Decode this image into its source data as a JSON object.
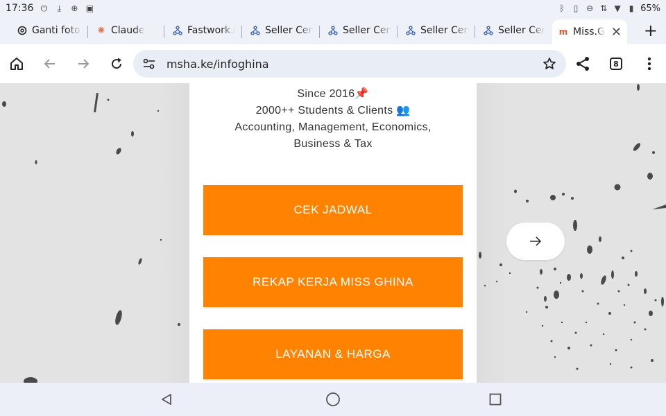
{
  "status_bar": {
    "time": "17:36",
    "battery": "65%"
  },
  "tabs": [
    {
      "title": "Ganti foto c",
      "icon": "openai-icon"
    },
    {
      "title": "Claude",
      "icon": "claude-icon"
    },
    {
      "title": "Fastwork.id",
      "icon": "fastwork-icon"
    },
    {
      "title": "Seller Cent",
      "icon": "seller-center-icon"
    },
    {
      "title": "Seller Cent",
      "icon": "seller-center-icon"
    },
    {
      "title": "Seller Cent",
      "icon": "seller-center-icon"
    },
    {
      "title": "Seller Cent",
      "icon": "seller-center-icon"
    },
    {
      "title": "Miss.Ghina",
      "icon": "msha-icon",
      "active": true
    }
  ],
  "toolbar": {
    "url": "msha.ke/infoghina",
    "tab_count": "8"
  },
  "page": {
    "intro_lines": [
      "Since 2016📌",
      "2000++ Students & Clients 👥",
      "Accounting, Management, Economics,",
      "Business & Tax"
    ],
    "buttons": [
      {
        "label": "CEK JADWAL"
      },
      {
        "label": "REKAP KERJA MISS GHINA"
      },
      {
        "label": "LAYANAN & HARGA"
      }
    ],
    "next_arrow": "→"
  },
  "colors": {
    "accent": "#ff8201",
    "background": "#e3e3e3",
    "card": "#ffffff"
  }
}
